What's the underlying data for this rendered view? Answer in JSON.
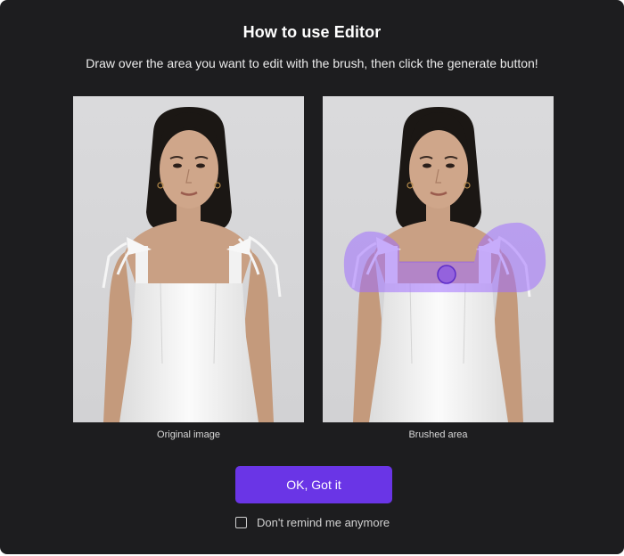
{
  "dialog": {
    "title": "How to use Editor",
    "subtitle": "Draw over the area you want to edit with the brush, then click the generate button!",
    "background_color": "#1d1d1f"
  },
  "examples": [
    {
      "caption": "Original image"
    },
    {
      "caption": "Brushed area",
      "brush_color": "#a070ff"
    }
  ],
  "confirm_button": {
    "label": "OK, Got it",
    "color": "#6a35e6"
  },
  "remind_option": {
    "label": "Don't remind me anymore",
    "checked": false
  }
}
